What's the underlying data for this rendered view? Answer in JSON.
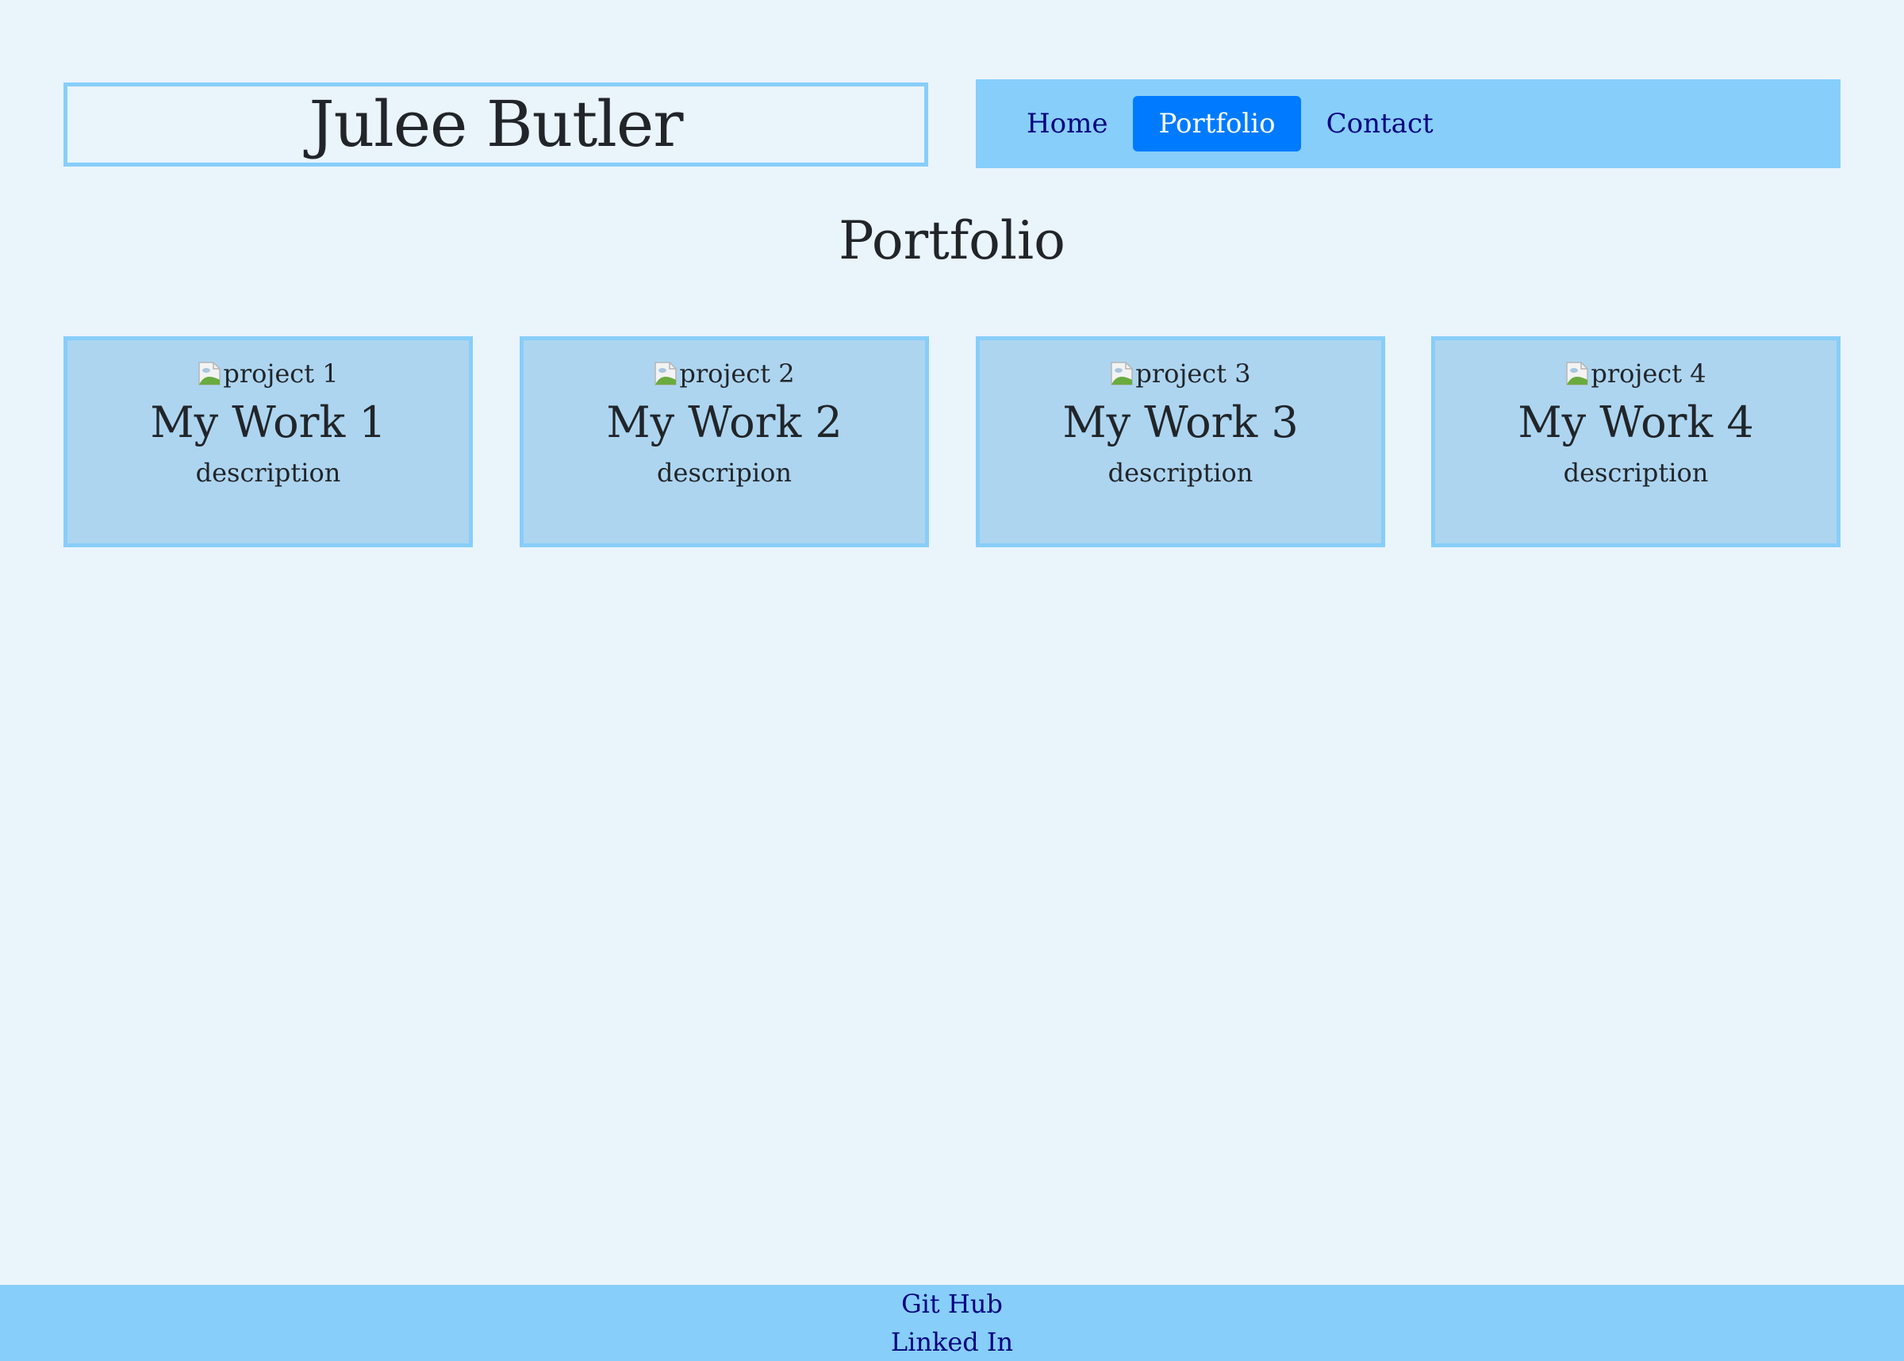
{
  "header": {
    "name": "Julee Butler"
  },
  "nav": {
    "items": [
      {
        "label": "Home",
        "active": false
      },
      {
        "label": "Portfolio",
        "active": true
      },
      {
        "label": "Contact",
        "active": false
      }
    ]
  },
  "main": {
    "heading": "Portfolio",
    "projects": [
      {
        "image_alt": "project 1",
        "title": "My Work 1",
        "description": "description"
      },
      {
        "image_alt": "project 2",
        "title": "My Work 2",
        "description": "descripion"
      },
      {
        "image_alt": "project 3",
        "title": "My Work 3",
        "description": "description"
      },
      {
        "image_alt": "project 4",
        "title": "My Work 4",
        "description": "description"
      }
    ]
  },
  "footer": {
    "links": [
      {
        "label": "Git Hub"
      },
      {
        "label": "Linked In"
      }
    ]
  },
  "colors": {
    "background": "#eaf4fb",
    "accent": "#87cefa",
    "card": "#add5f0",
    "active_nav": "#007bff",
    "link": "#000080"
  },
  "icons": {
    "image_placeholder": "broken-image-icon"
  }
}
